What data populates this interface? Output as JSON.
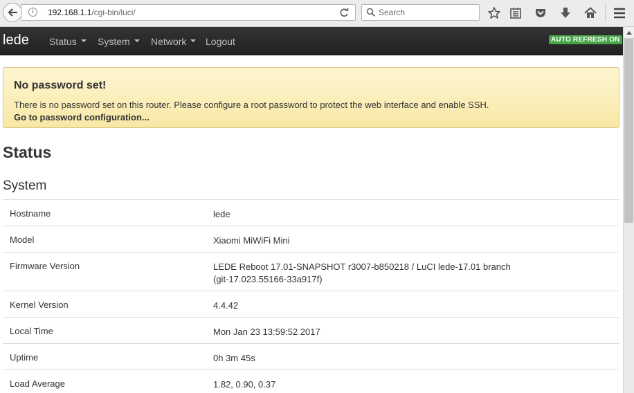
{
  "browser": {
    "url_host": "192.168.1.1",
    "url_path": "/cgi-bin/luci/",
    "search_placeholder": "Search"
  },
  "navbar": {
    "brand": "lede",
    "menus": [
      "Status",
      "System",
      "Network",
      "Logout"
    ],
    "auto_refresh": "AUTO REFRESH ON"
  },
  "alert": {
    "title": "No password set!",
    "message": "There is no password set on this router. Please configure a root password to protect the web interface and enable SSH.",
    "link": "Go to password configuration..."
  },
  "page": {
    "title": "Status",
    "section": "System"
  },
  "system": [
    {
      "label": "Hostname",
      "value": "lede"
    },
    {
      "label": "Model",
      "value": "Xiaomi MiWiFi Mini"
    },
    {
      "label": "Firmware Version",
      "value": "LEDE Reboot 17.01-SNAPSHOT r3007-b850218 / LuCI lede-17.01 branch",
      "value2": "(git-17.023.55166-33a917f)"
    },
    {
      "label": "Kernel Version",
      "value": "4.4.42"
    },
    {
      "label": "Local Time",
      "value": "Mon Jan 23 13:59:52 2017"
    },
    {
      "label": "Uptime",
      "value": "0h 3m 45s"
    },
    {
      "label": "Load Average",
      "value": "1.82, 0.90, 0.37"
    }
  ]
}
